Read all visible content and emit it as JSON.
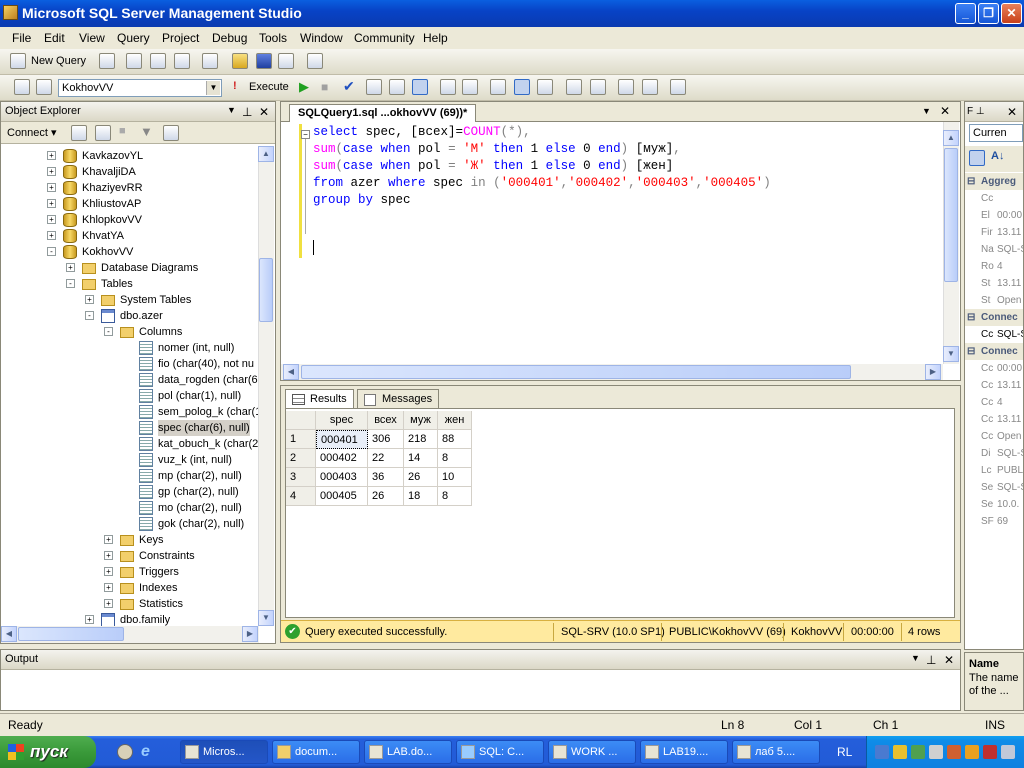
{
  "window": {
    "title": "Microsoft SQL Server Management Studio"
  },
  "menu": [
    "File",
    "Edit",
    "View",
    "Query",
    "Project",
    "Debug",
    "Tools",
    "Window",
    "Community",
    "Help"
  ],
  "toolbar": {
    "new_query": "New Query",
    "database": "KokhovVV",
    "execute": "Execute"
  },
  "object_explorer": {
    "title": "Object Explorer",
    "connect": "Connect",
    "items": [
      {
        "label": "KavkazovYL",
        "level": 0,
        "type": "db",
        "expand": "+"
      },
      {
        "label": "KhavaljiDA",
        "level": 0,
        "type": "db",
        "expand": "+"
      },
      {
        "label": "KhaziyevRR",
        "level": 0,
        "type": "db",
        "expand": "+"
      },
      {
        "label": "KhliustovAP",
        "level": 0,
        "type": "db",
        "expand": "+"
      },
      {
        "label": "KhlopkovVV",
        "level": 0,
        "type": "db",
        "expand": "+"
      },
      {
        "label": "KhvatYA",
        "level": 0,
        "type": "db",
        "expand": "+"
      },
      {
        "label": "KokhovVV",
        "level": 0,
        "type": "db",
        "expand": "-"
      },
      {
        "label": "Database Diagrams",
        "level": 1,
        "type": "fold",
        "expand": "+"
      },
      {
        "label": "Tables",
        "level": 1,
        "type": "fold",
        "expand": "-"
      },
      {
        "label": "System Tables",
        "level": 2,
        "type": "fold",
        "expand": "+"
      },
      {
        "label": "dbo.azer",
        "level": 2,
        "type": "tbl",
        "expand": "-"
      },
      {
        "label": "Columns",
        "level": 3,
        "type": "fold",
        "expand": "-"
      },
      {
        "label": "nomer (int, null)",
        "level": 4,
        "type": "col",
        "expand": ""
      },
      {
        "label": "fio (char(40), not nu",
        "level": 4,
        "type": "col",
        "expand": ""
      },
      {
        "label": "data_rogden (char(6",
        "level": 4,
        "type": "col",
        "expand": ""
      },
      {
        "label": "pol (char(1), null)",
        "level": 4,
        "type": "col",
        "expand": ""
      },
      {
        "label": "sem_polog_k (char(1",
        "level": 4,
        "type": "col",
        "expand": ""
      },
      {
        "label": "spec (char(6), null)",
        "level": 4,
        "type": "col",
        "expand": ""
      },
      {
        "label": "kat_obuch_k (char(2",
        "level": 4,
        "type": "col",
        "expand": ""
      },
      {
        "label": "vuz_k (int, null)",
        "level": 4,
        "type": "col",
        "expand": ""
      },
      {
        "label": "mp (char(2), null)",
        "level": 4,
        "type": "col",
        "expand": ""
      },
      {
        "label": "gp (char(2), null)",
        "level": 4,
        "type": "col",
        "expand": ""
      },
      {
        "label": "mo (char(2), null)",
        "level": 4,
        "type": "col",
        "expand": ""
      },
      {
        "label": "gok (char(2), null)",
        "level": 4,
        "type": "col",
        "expand": ""
      },
      {
        "label": "Keys",
        "level": 3,
        "type": "fold",
        "expand": "+"
      },
      {
        "label": "Constraints",
        "level": 3,
        "type": "fold",
        "expand": "+"
      },
      {
        "label": "Triggers",
        "level": 3,
        "type": "fold",
        "expand": "+"
      },
      {
        "label": "Indexes",
        "level": 3,
        "type": "fold",
        "expand": "+"
      },
      {
        "label": "Statistics",
        "level": 3,
        "type": "fold",
        "expand": "+"
      },
      {
        "label": "dbo.family",
        "level": 2,
        "type": "tbl",
        "expand": "+"
      }
    ]
  },
  "editor": {
    "tab": "SQLQuery1.sql ...okhovVV (69))*",
    "lines": [
      [
        [
          "kw",
          "select"
        ],
        [
          "",
          "spec, [всех]="
        ],
        [
          "fn",
          "COUNT"
        ],
        [
          "gr",
          "(*),"
        ]
      ],
      [
        [
          "fn",
          "sum"
        ],
        [
          "gr",
          "("
        ],
        [
          "kw",
          "case when"
        ],
        [
          "",
          " pol "
        ],
        [
          "gr",
          "="
        ],
        [
          "",
          ""
        ],
        [
          "st",
          " 'М' "
        ],
        [
          "kw",
          "then"
        ],
        [
          "",
          ""
        ],
        [
          "",
          " 1 "
        ],
        [
          "kw",
          "else"
        ],
        [
          "",
          " 0 "
        ],
        [
          "kw",
          "end"
        ],
        [
          "gr",
          ")"
        ],
        [
          "",
          " [муж]"
        ],
        [
          "gr",
          ","
        ]
      ],
      [
        [
          "fn",
          "sum"
        ],
        [
          "gr",
          "("
        ],
        [
          "kw",
          "case when"
        ],
        [
          "",
          " pol "
        ],
        [
          "gr",
          "="
        ],
        [
          "st",
          " 'Ж' "
        ],
        [
          "kw",
          "then"
        ],
        [
          "",
          " 1 "
        ],
        [
          "kw",
          "else"
        ],
        [
          "",
          " 0 "
        ],
        [
          "kw",
          "end"
        ],
        [
          "gr",
          ")"
        ],
        [
          "",
          " [жен]"
        ]
      ],
      [
        [
          "kw",
          "from"
        ],
        [
          "",
          " azer "
        ],
        [
          "kw",
          "where"
        ],
        [
          "",
          " spec "
        ],
        [
          "gr",
          "in ("
        ],
        [
          "st",
          "'000401'"
        ],
        [
          "gr",
          ","
        ],
        [
          "st",
          "'000402'"
        ],
        [
          "gr",
          ","
        ],
        [
          "st",
          "'000403'"
        ],
        [
          "gr",
          ","
        ],
        [
          "st",
          "'000405'"
        ],
        [
          "gr",
          ")"
        ]
      ],
      [
        [
          "kw",
          "group by"
        ],
        [
          "",
          " spec"
        ]
      ]
    ]
  },
  "results": {
    "tab_results": "Results",
    "tab_messages": "Messages",
    "columns": [
      "spec",
      "всех",
      "муж",
      "жен"
    ],
    "rows": [
      [
        "1",
        "000401",
        "306",
        "218",
        "88"
      ],
      [
        "2",
        "000402",
        "22",
        "14",
        "8"
      ],
      [
        "3",
        "000403",
        "36",
        "26",
        "10"
      ],
      [
        "4",
        "000405",
        "26",
        "18",
        "8"
      ]
    ],
    "status": {
      "message": "Query executed successfully.",
      "server": "SQL-SRV (10.0 SP1)",
      "login": "PUBLIC\\KokhovVV (69)",
      "db": "KokhovVV",
      "time": "00:00:00",
      "rows": "4 rows"
    }
  },
  "properties": {
    "combo": "Curren",
    "rows": [
      {
        "cat": true,
        "k": "Aggreg",
        "v": ""
      },
      {
        "k": "Cc",
        "v": ""
      },
      {
        "k": "El",
        "v": "00:00"
      },
      {
        "k": "Fir",
        "v": "13.11"
      },
      {
        "k": "Na",
        "v": "SQL-S"
      },
      {
        "k": "Ro",
        "v": "4"
      },
      {
        "k": "St",
        "v": "13.11"
      },
      {
        "k": "St",
        "v": "Open"
      },
      {
        "cat": true,
        "k": "Connec",
        "v": ""
      },
      {
        "k": "Cc",
        "v": "SQL-S"
      },
      {
        "cat": true,
        "k": "Connec",
        "v": ""
      },
      {
        "k": "Cc",
        "v": "00:00"
      },
      {
        "k": "Cc",
        "v": "13.11"
      },
      {
        "k": "Cc",
        "v": "4"
      },
      {
        "k": "Cc",
        "v": "13.11"
      },
      {
        "k": "Cc",
        "v": "Open"
      },
      {
        "k": "Di",
        "v": "SQL-S"
      },
      {
        "k": "Lc",
        "v": "PUBLI"
      },
      {
        "k": "Se",
        "v": "SQL-S"
      },
      {
        "k": "Se",
        "v": "10.0."
      },
      {
        "k": "SF",
        "v": "69"
      }
    ],
    "desc_title": "Name",
    "desc_text": "The name of the ..."
  },
  "output": {
    "title": "Output"
  },
  "statusbar": {
    "ready": "Ready",
    "ln": "Ln 8",
    "col": "Col 1",
    "ch": "Ch 1",
    "ins": "INS"
  },
  "taskbar": {
    "start": "пуск",
    "tasks": [
      "Micros...",
      "docum...",
      "LAB.do...",
      "SQL: C...",
      "WORK ...",
      "LAB19....",
      "лаб 5...."
    ],
    "lang": "RL"
  }
}
